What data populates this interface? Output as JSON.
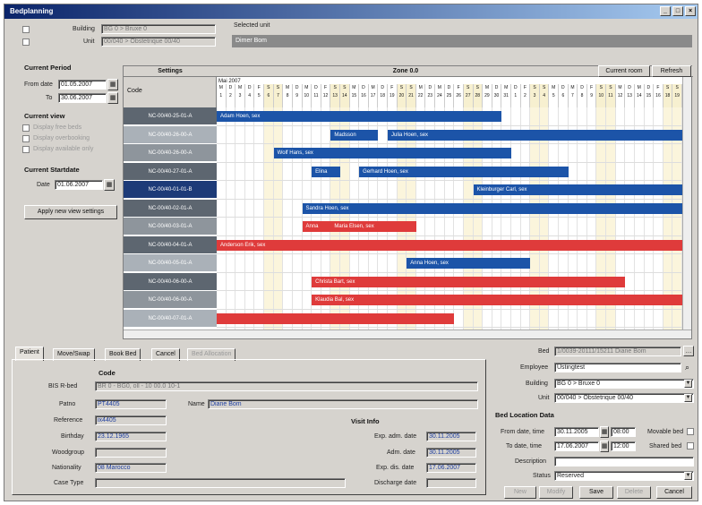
{
  "window": {
    "title": "Bedplanning"
  },
  "top": {
    "building_label": "Building",
    "building_value": "BG 0 > Bruxe 0",
    "unit_label": "Unit",
    "unit_value": "00/040 > Obstetrique 00/40",
    "selected_unit_label": "Selected unit",
    "selected_unit_value": "Dimer Bom"
  },
  "left": {
    "current_period": "Current Period",
    "from_date_label": "From date",
    "from_date": "01.05.2007",
    "to_label": "To",
    "to_date": "30.06.2007",
    "current_view": "Current view",
    "view_options": [
      "Display free beds",
      "Display overbooking",
      "Display available only"
    ],
    "current_startdate": "Current Startdate",
    "date_label": "Date",
    "date_value": "01.06.2007",
    "apply_button": "Apply new view settings"
  },
  "sched": {
    "settings_label": "Settings",
    "zone_label": "Zone 0.0",
    "current_room": "Current room",
    "refresh": "Refresh",
    "code_header": "Code",
    "month_label": "Mai 2007",
    "days": [
      "M",
      "D",
      "M",
      "D",
      "F",
      "S",
      "S",
      "M",
      "D",
      "M",
      "D",
      "F",
      "S",
      "S",
      "M",
      "D",
      "M",
      "D",
      "F",
      "S",
      "S",
      "M",
      "D",
      "M",
      "D",
      "F",
      "S",
      "S",
      "M",
      "D",
      "M",
      "D",
      "F",
      "S",
      "S",
      "M",
      "D",
      "M",
      "D",
      "F",
      "S",
      "S",
      "M",
      "D",
      "M",
      "D",
      "F",
      "S",
      "S"
    ],
    "day_nums": [
      "1",
      "2",
      "3",
      "4",
      "5",
      "6",
      "7",
      "8",
      "9",
      "10",
      "11",
      "12",
      "13",
      "14",
      "15",
      "16",
      "17",
      "18",
      "19",
      "20",
      "21",
      "22",
      "23",
      "24",
      "25",
      "26",
      "27",
      "28",
      "29",
      "30",
      "31",
      "1",
      "2",
      "3",
      "4",
      "5",
      "6",
      "7",
      "8",
      "9",
      "10",
      "11",
      "12",
      "13",
      "14",
      "15",
      "16",
      "18",
      "19"
    ],
    "rows": [
      "NC-00/40-25-01-A",
      "NC-00/40-26-00-A",
      "NC-00/40-26-00-A",
      "NC-00/40-27-01-A",
      "NC-00/40-01-01-B",
      "NC-00/40-02-01-A",
      "NC-00/40-03-01-A",
      "NC-00/40-04-01-A",
      "NC-00/40-05-01-A",
      "NC-00/40-06-00-A",
      "NC-00/40-06-00-A",
      "NC-00/40-07-01-A"
    ],
    "bars": [
      {
        "row": 0,
        "start": 0,
        "len": 30,
        "type": "b",
        "text": "Adam Hoen, sex"
      },
      {
        "row": 1,
        "start": 12,
        "len": 5,
        "type": "b",
        "text": "Madsson"
      },
      {
        "row": 1,
        "start": 18,
        "len": 31,
        "type": "b",
        "text": "Julia Hoen, sex"
      },
      {
        "row": 2,
        "start": 6,
        "len": 25,
        "type": "b",
        "text": "Wolf Hans, sex"
      },
      {
        "row": 3,
        "start": 10,
        "len": 3,
        "type": "b",
        "text": "Elina"
      },
      {
        "row": 3,
        "start": 15,
        "len": 22,
        "type": "b",
        "text": "Gerhard Hoen, sex"
      },
      {
        "row": 4,
        "start": 27,
        "len": 22,
        "type": "b",
        "text": "Kleinburger Carl, sex"
      },
      {
        "row": 5,
        "start": 9,
        "len": 40,
        "type": "b",
        "text": "Sandra Hoen, sex"
      },
      {
        "row": 6,
        "start": 9,
        "len": 3,
        "type": "r",
        "text": "Anna"
      },
      {
        "row": 6,
        "start": 12,
        "len": 9,
        "type": "r",
        "text": "Maria Elsen, sex"
      },
      {
        "row": 7,
        "start": 0,
        "len": 49,
        "type": "r",
        "text": "Anderson Erik, sex"
      },
      {
        "row": 8,
        "start": 20,
        "len": 13,
        "type": "b",
        "text": "Anna Hoen, sex"
      },
      {
        "row": 9,
        "start": 10,
        "len": 33,
        "type": "r",
        "text": "Christa Bart, sex"
      },
      {
        "row": 10,
        "start": 10,
        "len": 39,
        "type": "r",
        "text": "Klaudia Bal, sex"
      },
      {
        "row": 11,
        "start": 0,
        "len": 25,
        "type": "r",
        "text": ""
      }
    ]
  },
  "tabs": [
    "Patient",
    "Move/Swap",
    "Book Bed",
    "Cancel",
    "Bed Allocation"
  ],
  "patient": {
    "code_header": "Code",
    "bed_label": "BIS R-bed",
    "bed_value": "BR 0 - BG0, oll - 10 00.0 10-1",
    "patno_label": "Patno",
    "patno_value": "PT4405",
    "reference_label": "Reference",
    "reference_value": "ix4405",
    "name_label": "Name",
    "name_value": "Diane Bom",
    "birthday_label": "Birthday",
    "birthday_value": "23.12.1965",
    "woodgroup_label": "Woodgroup",
    "nationality_label": "Nationality",
    "nationality_value": "08 Marocco",
    "case_type_label": "Case Type",
    "visit_info": "Visit Info",
    "exp_adm_label": "Exp. adm. date",
    "exp_adm": "30.11.2005",
    "adm_label": "Adm. date",
    "adm": "30.11.2005",
    "exp_dis_label": "Exp. dis. date",
    "exp_dis": "17.06.2007",
    "discharge_label": "Discharge date"
  },
  "right": {
    "bed_label": "Bed",
    "bed_value": "1/0039-20111/15211 Diane Bom",
    "employee_label": "Employee",
    "employee_value": "Ustingtest",
    "building_label": "Building",
    "building_value": "BG 0 > Bruxe 0",
    "unit_label": "Unit",
    "unit_value": "00/040 > Obstetrique 00/40",
    "bed_loc_header": "Bed Location Data",
    "from_label": "From date, time",
    "from_date": "30.11.2005",
    "from_time": "08:00",
    "to_label": "To date, time",
    "to_date": "17.06.2007",
    "to_time": "12:00",
    "movable_label": "Movable bed",
    "shared_label": "Shared bed",
    "desc_label": "Description",
    "status_label": "Status",
    "status_value": "Reserved",
    "buttons": [
      "New",
      "Modify",
      "Save",
      "Delete",
      "Cancel"
    ]
  }
}
